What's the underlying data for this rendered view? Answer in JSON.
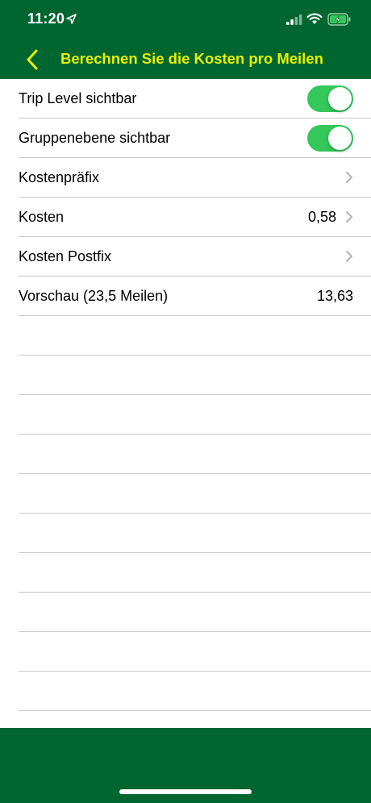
{
  "status": {
    "time": "11:20",
    "icons": [
      "location-arrow-icon",
      "cellular-signal-icon",
      "wifi-icon",
      "battery-charging-icon"
    ]
  },
  "nav": {
    "title": "Berechnen Sie die Kosten pro Meilen",
    "back_icon": "chevron-left-icon"
  },
  "colors": {
    "bar_green": "#006630",
    "title_yellow": "#e6f000",
    "toggle_on": "#34c759",
    "separator": "#c8c8c8"
  },
  "settings": {
    "trip_level": {
      "label": "Trip Level sichtbar",
      "on": true
    },
    "group_level": {
      "label": "Gruppenebene sichtbar",
      "on": true
    },
    "cost_prefix": {
      "label": "Kostenpräfix",
      "value": ""
    },
    "cost": {
      "label": "Kosten",
      "value": "0,58"
    },
    "cost_postfix": {
      "label": "Kosten Postfix",
      "value": ""
    },
    "preview": {
      "label": "Vorschau (23,5 Meilen)",
      "value": "13,63"
    }
  }
}
